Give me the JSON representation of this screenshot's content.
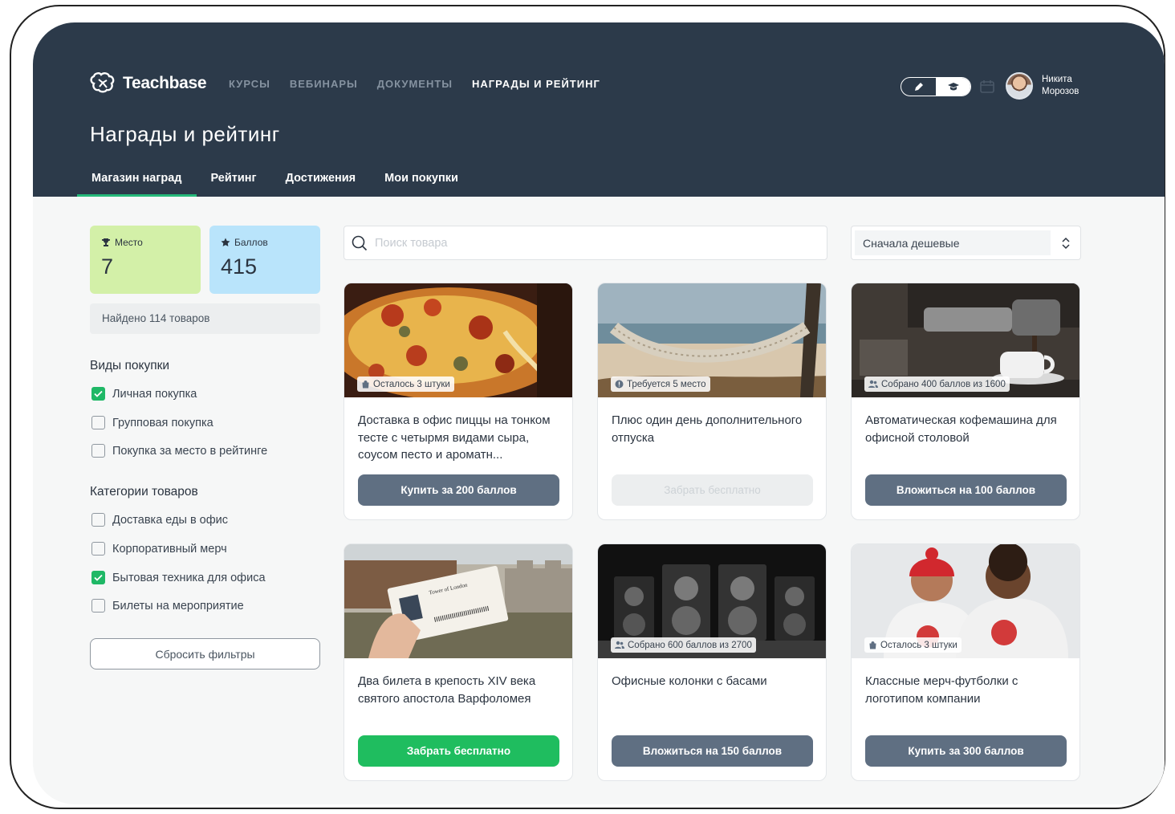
{
  "app": {
    "logo_text": "Teachbase",
    "nav": [
      "КУРСЫ",
      "ВЕБИНАРЫ",
      "ДОКУМЕНТЫ",
      "НАГРАДЫ И РЕЙТИНГ"
    ],
    "user": {
      "first": "Никита",
      "last": "Морозов"
    }
  },
  "page": {
    "title": "Награды и рейтинг",
    "tabs": [
      "Магазин наград",
      "Рейтинг",
      "Достижения",
      "Мои покупки"
    ]
  },
  "sidebar": {
    "place": {
      "label": "Место",
      "value": "7"
    },
    "points": {
      "label": "Баллов",
      "value": "415"
    },
    "found": "Найдено 114 товаров",
    "purchase_types": {
      "title": "Виды покупки",
      "items": [
        {
          "label": "Личная покупка",
          "checked": true
        },
        {
          "label": "Групповая покупка",
          "checked": false
        },
        {
          "label": "Покупка за место в рейтинге",
          "checked": false
        }
      ]
    },
    "categories": {
      "title": "Категории товаров",
      "items": [
        {
          "label": "Доставка еды в офис",
          "checked": false
        },
        {
          "label": "Корпоративный мерч",
          "checked": false
        },
        {
          "label": "Бытовая техника для офиса",
          "checked": true
        },
        {
          "label": "Билеты на мероприятие",
          "checked": false
        }
      ]
    },
    "reset_label": "Сбросить фильтры"
  },
  "search": {
    "placeholder": "Поиск товара",
    "value": ""
  },
  "sort": {
    "selected": "Сначала дешевые"
  },
  "products": [
    {
      "badge": "Осталось 3 штуки",
      "badge_icon": "bag-icon",
      "title": "Доставка в офис пиццы на тонком тесте с четырмя видами сыра, соусом песто и ароматн...",
      "button": "Купить за 200 баллов",
      "style": "dark"
    },
    {
      "badge": "Требуется 5 место",
      "badge_icon": "alert-icon",
      "title": "Плюс один день дополнительного отпуска",
      "button": "Забрать бесплатно",
      "style": "disabled"
    },
    {
      "badge": "Собрано 400 баллов из 1600",
      "badge_icon": "group-icon",
      "title": "Автоматическая кофемашина для офисной столовой",
      "button": "Вложиться на 100 баллов",
      "style": "dark"
    },
    {
      "badge": "",
      "badge_icon": "",
      "title": "Два билета в крепость XIV века святого апостола Варфоломея",
      "button": "Забрать бесплатно",
      "style": "green"
    },
    {
      "badge": "Собрано 600 баллов из 2700",
      "badge_icon": "group-icon",
      "title": "Офисные колонки с басами",
      "button": "Вложиться на 150 баллов",
      "style": "dark"
    },
    {
      "badge": "Осталось 3 штуки",
      "badge_icon": "bag-icon",
      "title": "Классные мерч-футболки с логотипом компании",
      "button": "Купить за 300 баллов",
      "style": "dark"
    }
  ],
  "ticket_text": "Tower of London",
  "colors": {
    "header": "#2c3a4a",
    "accent_green": "#1fbd5f",
    "button_dark": "#5f6f82",
    "place_bg": "#d3f0a8",
    "points_bg": "#b9e4fb"
  }
}
